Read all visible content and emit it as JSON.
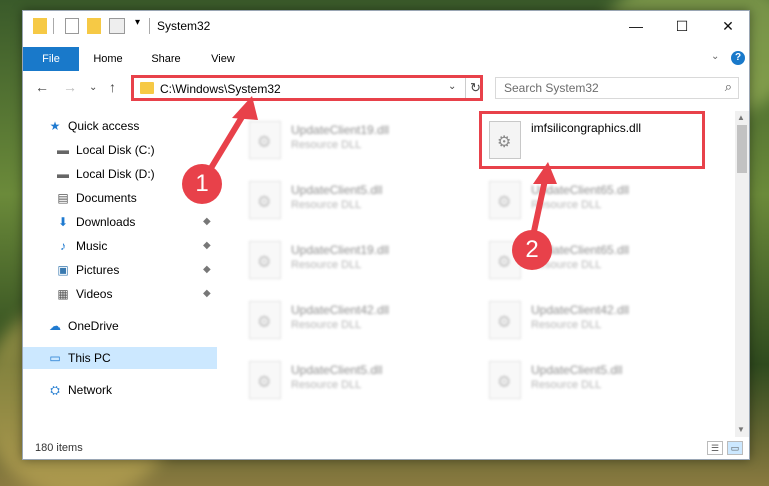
{
  "window": {
    "title": "System32",
    "minimize": "—",
    "maximize": "☐",
    "close": "✕"
  },
  "ribbon": {
    "tabs": [
      "File",
      "Home",
      "Share",
      "View"
    ],
    "collapse": "⌄",
    "help": "?"
  },
  "address": {
    "path": "C:\\Windows\\System32",
    "refresh": "↻",
    "dropdown": "⌄"
  },
  "search": {
    "placeholder": "Search System32",
    "icon": "⌕"
  },
  "nav": {
    "back": "←",
    "forward": "→",
    "recent": "⌄",
    "up": "↑"
  },
  "sidebar": {
    "items": [
      {
        "label": "Quick access",
        "icon": "★"
      },
      {
        "label": "Local Disk (C:)",
        "icon": "▬"
      },
      {
        "label": "Local Disk (D:)",
        "icon": "▬"
      },
      {
        "label": "Documents",
        "icon": "▤"
      },
      {
        "label": "Downloads",
        "icon": "⬇"
      },
      {
        "label": "Music",
        "icon": "♪"
      },
      {
        "label": "Pictures",
        "icon": "▣"
      },
      {
        "label": "Videos",
        "icon": "▦"
      },
      {
        "label": "OneDrive",
        "icon": "☁"
      },
      {
        "label": "This PC",
        "icon": "▭"
      },
      {
        "label": "Network",
        "icon": "⛭"
      }
    ],
    "pin_icon": "📌"
  },
  "files": {
    "left": [
      {
        "name": "UpdateClient19.dll",
        "type": "Resource DLL"
      },
      {
        "name": "UpdateClient5.dll",
        "type": "Resource DLL"
      },
      {
        "name": "UpdateClient19.dll",
        "type": "Resource DLL"
      },
      {
        "name": "UpdateClient42.dll",
        "type": "Resource DLL"
      },
      {
        "name": "UpdateClient5.dll",
        "type": "Resource DLL"
      }
    ],
    "right": [
      {
        "name": "imfsilicongraphics.dll",
        "type": ""
      },
      {
        "name": "UpdateClient65.dll",
        "type": "Resource DLL"
      },
      {
        "name": "UpdateClient65.dll",
        "type": "Resource DLL"
      },
      {
        "name": "UpdateClient42.dll",
        "type": "Resource DLL"
      },
      {
        "name": "UpdateClient5.dll",
        "type": "Resource DLL"
      }
    ]
  },
  "status": {
    "count": "180 items"
  },
  "annotations": {
    "badge1": "1",
    "badge2": "2",
    "accent": "#e8414a"
  }
}
